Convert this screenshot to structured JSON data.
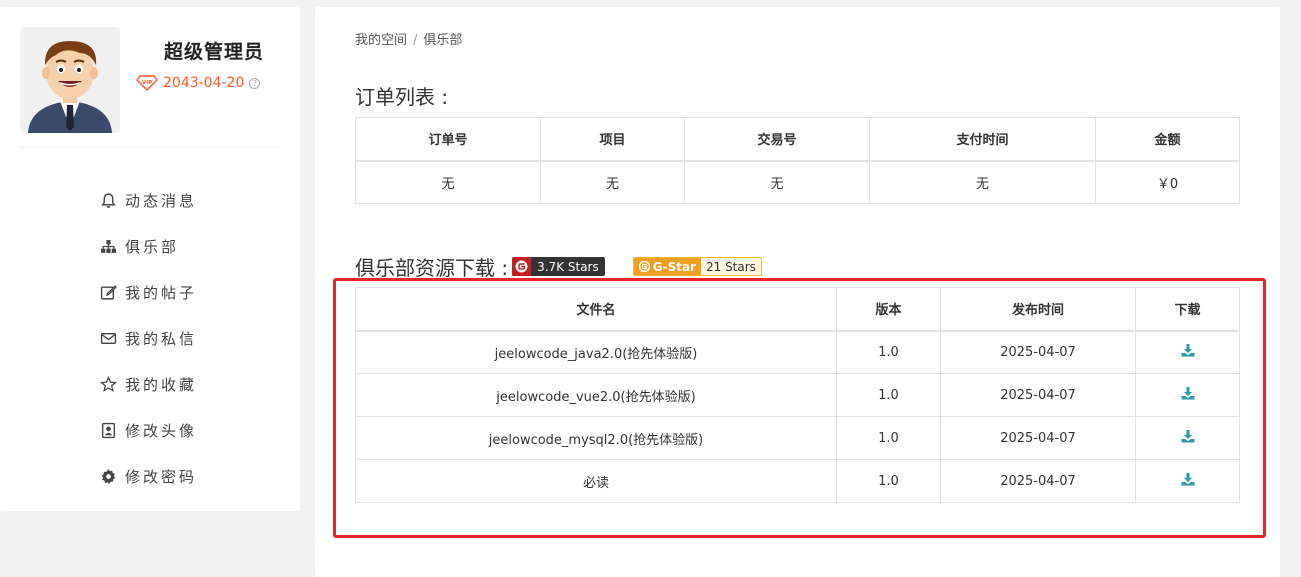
{
  "user": {
    "name": "超级管理员",
    "vip_label": "VIP",
    "vip_expiry": "2043-04-20",
    "help_glyph": "?"
  },
  "menu": [
    {
      "label": "动态消息",
      "icon": "bell-icon"
    },
    {
      "label": "俱乐部",
      "icon": "sitemap-icon"
    },
    {
      "label": "我的帖子",
      "icon": "edit-icon"
    },
    {
      "label": "我的私信",
      "icon": "envelope-icon"
    },
    {
      "label": "我的收藏",
      "icon": "star-icon"
    },
    {
      "label": "修改头像",
      "icon": "portrait-icon"
    },
    {
      "label": "修改密码",
      "icon": "gear-icon"
    }
  ],
  "breadcrumb": {
    "root": "我的空间",
    "sep": "/",
    "current": "俱乐部"
  },
  "orders": {
    "title": "订单列表 :",
    "headers": [
      "订单号",
      "项目",
      "交易号",
      "支付时间",
      "金额"
    ],
    "rows": [
      [
        "无",
        "无",
        "无",
        "无",
        "￥0"
      ]
    ]
  },
  "downloads": {
    "title": "俱乐部资源下载 :",
    "gitee_badge": "3.7K Stars",
    "gstar_left": "G-Star",
    "gstar_right": "21 Stars",
    "headers": [
      "文件名",
      "版本",
      "发布时间",
      "下载"
    ],
    "rows": [
      {
        "name": "jeelowcode_java2.0(抢先体验版)",
        "version": "1.0",
        "date": "2025-04-07"
      },
      {
        "name": "jeelowcode_vue2.0(抢先体验版)",
        "version": "1.0",
        "date": "2025-04-07"
      },
      {
        "name": "jeelowcode_mysql2.0(抢先体验版)",
        "version": "1.0",
        "date": "2025-04-07"
      },
      {
        "name": "必读",
        "version": "1.0",
        "date": "2025-04-07"
      }
    ]
  },
  "colors": {
    "accent": "#ff5722",
    "download": "#1e9fff",
    "highlight": "#e8262a"
  }
}
